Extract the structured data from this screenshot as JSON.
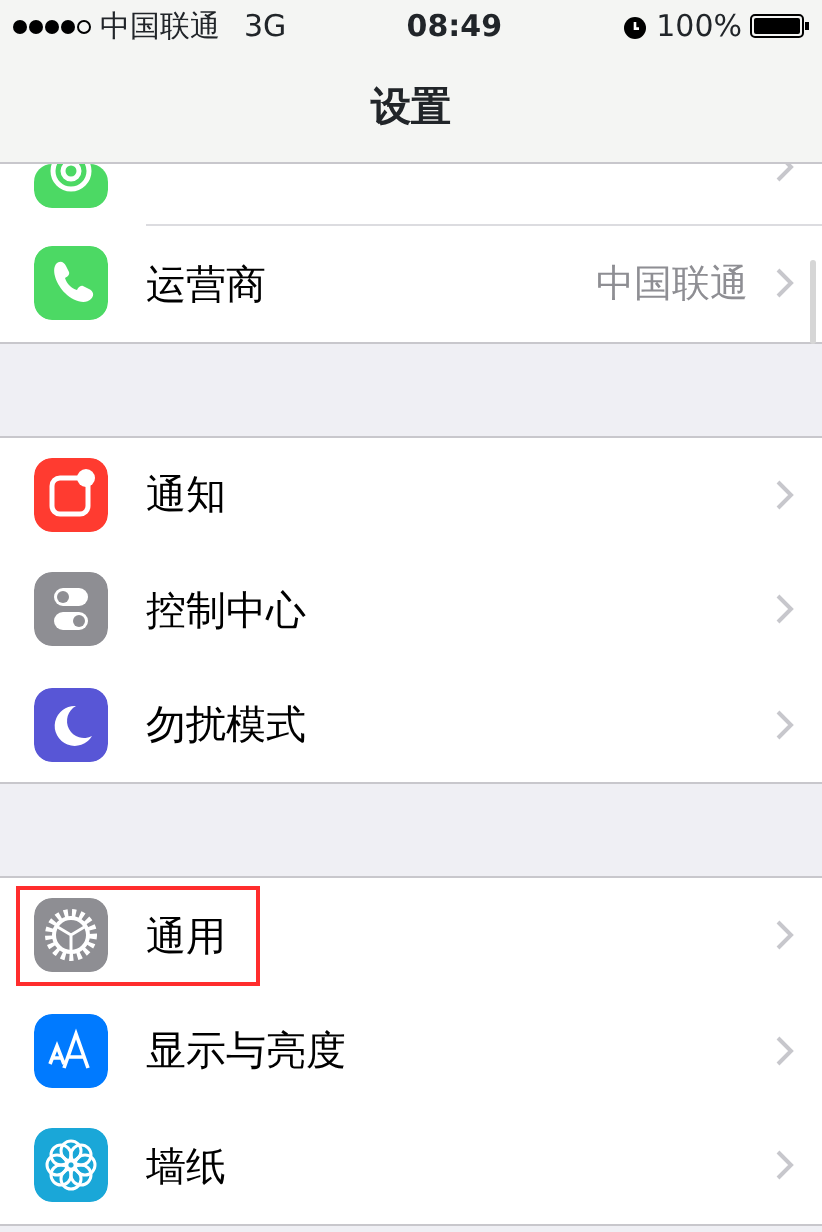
{
  "status_bar": {
    "carrier": "中国联通",
    "network": "3G",
    "time": "08:49",
    "battery": "100%"
  },
  "nav": {
    "title": "设置"
  },
  "groups": [
    {
      "rows": [
        {
          "color": "#4cd964"
        },
        {
          "color": "#4cd964",
          "label": "运营商",
          "value": "中国联通",
          "highlighted": false
        }
      ]
    },
    {
      "rows": [
        {
          "color": "#ff3b30",
          "label": "通知",
          "highlighted": false
        },
        {
          "color": "#8e8e93",
          "label": "控制中心",
          "highlighted": false
        },
        {
          "color": "#5856d6",
          "label": "勿扰模式",
          "highlighted": false
        }
      ]
    },
    {
      "rows": [
        {
          "color": "#8e8e93",
          "label": "通用",
          "highlighted": true
        },
        {
          "color": "#007aff",
          "label": "显示与亮度",
          "highlighted": false
        },
        {
          "color": "#1aa7d8",
          "label": "墙纸",
          "highlighted": false
        }
      ]
    }
  ]
}
